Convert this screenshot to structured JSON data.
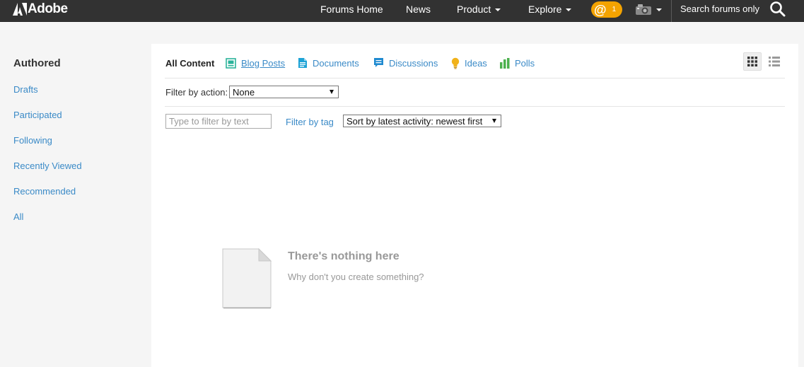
{
  "header": {
    "logo_text": "Adobe",
    "nav": {
      "forums_home": "Forums Home",
      "news": "News",
      "product": "Product",
      "explore": "Explore"
    },
    "mentions_count": "1",
    "search_label": "Search forums only"
  },
  "sidebar": {
    "title": "Authored",
    "items": [
      {
        "label": "Drafts"
      },
      {
        "label": "Participated"
      },
      {
        "label": "Following"
      },
      {
        "label": "Recently Viewed"
      },
      {
        "label": "Recommended"
      },
      {
        "label": "All"
      }
    ]
  },
  "tabs": [
    {
      "label": "All Content",
      "icon": "none",
      "active": true
    },
    {
      "label": "Blog Posts",
      "icon": "blog-icon"
    },
    {
      "label": "Documents",
      "icon": "document-icon"
    },
    {
      "label": "Discussions",
      "icon": "discussion-icon"
    },
    {
      "label": "Ideas",
      "icon": "idea-icon"
    },
    {
      "label": "Polls",
      "icon": "poll-icon"
    }
  ],
  "filters": {
    "action_label": "Filter by action:",
    "action_value": "None",
    "text_placeholder": "Type to filter by text",
    "tag_label": "Filter by tag",
    "sort_value": "Sort by latest activity: newest first"
  },
  "empty_state": {
    "title": "There's nothing here",
    "subtitle": "Why don't you create something?"
  },
  "colors": {
    "topbar": "#323232",
    "link": "#3a8ac7",
    "accent_orange": "#f4a300",
    "icon_teal": "#2bb39a",
    "icon_blue": "#1ea3d6",
    "icon_yellow": "#f1b21a",
    "icon_green": "#4cb14d"
  }
}
